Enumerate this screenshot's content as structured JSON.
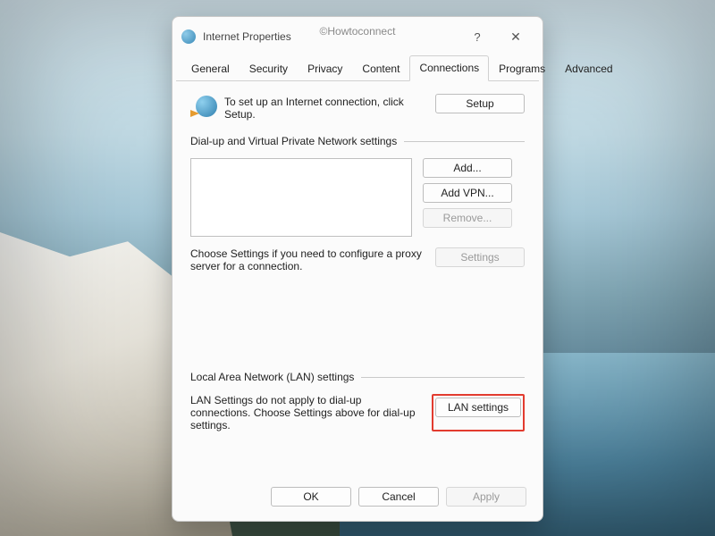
{
  "watermark": "©Howtoconnect",
  "window": {
    "title": "Internet Properties",
    "help": "?",
    "close": "✕"
  },
  "tabs": {
    "items": [
      {
        "label": "General"
      },
      {
        "label": "Security"
      },
      {
        "label": "Privacy"
      },
      {
        "label": "Content"
      },
      {
        "label": "Connections"
      },
      {
        "label": "Programs"
      },
      {
        "label": "Advanced"
      }
    ],
    "active": "Connections"
  },
  "setup": {
    "text": "To set up an Internet connection, click Setup.",
    "button": "Setup"
  },
  "dialup": {
    "heading": "Dial-up and Virtual Private Network settings",
    "add": "Add...",
    "addvpn": "Add VPN...",
    "remove": "Remove...",
    "settings": "Settings",
    "choose": "Choose Settings if you need to configure a proxy server for a connection."
  },
  "lan": {
    "heading": "Local Area Network (LAN) settings",
    "text": "LAN Settings do not apply to dial-up connections. Choose Settings above for dial-up settings.",
    "button": "LAN settings"
  },
  "footer": {
    "ok": "OK",
    "cancel": "Cancel",
    "apply": "Apply"
  }
}
